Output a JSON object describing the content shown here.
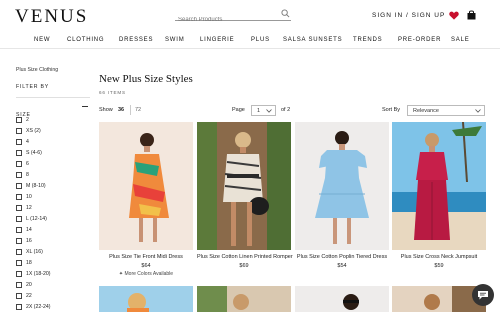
{
  "header": {
    "logo": "VENUS",
    "search_placeholder": "Search Products",
    "signin": "SIGN IN / SIGN UP",
    "icons": [
      "search-icon",
      "heart-icon",
      "bag-icon"
    ],
    "accent_color": "#c8102e"
  },
  "nav": {
    "items": [
      "NEW",
      "CLOTHING",
      "DRESSES",
      "SWIM",
      "LINGERIE",
      "PLUS",
      "SALSA SUNSETS",
      "TRENDS",
      "PRE-ORDER",
      "SALE"
    ]
  },
  "sidebar": {
    "breadcrumb": "Plus Size Clothing",
    "filter_by": "FILTER BY",
    "size_heading": "SIZE",
    "sizes": [
      "2",
      "XS (2)",
      "4",
      "S (4-6)",
      "6",
      "8",
      "M (8-10)",
      "10",
      "12",
      "L (12-14)",
      "14",
      "16",
      "XL (16)",
      "18",
      "1X (18-20)",
      "20",
      "22",
      "2X (22-24)"
    ]
  },
  "main": {
    "title": "New Plus Size Styles",
    "item_count": "66 ITEMS",
    "show_label": "Show",
    "show_options": [
      "36",
      "72"
    ],
    "page_label": "Page",
    "page_value": "1",
    "page_of": "of 2",
    "sort_label": "Sort By",
    "sort_value": "Relevance"
  },
  "products": [
    {
      "name": "Plus Size Tie Front Midi Dress",
      "price": "$64",
      "more": "More Colors Available"
    },
    {
      "name": "Plus Size Cotton Linen Printed Romper",
      "price": "$69"
    },
    {
      "name": "Plus Size Cotton Poplin Tiered Dress",
      "price": "$54"
    },
    {
      "name": "Plus Size Cross Neck Jumpsuit",
      "price": "$59"
    }
  ]
}
